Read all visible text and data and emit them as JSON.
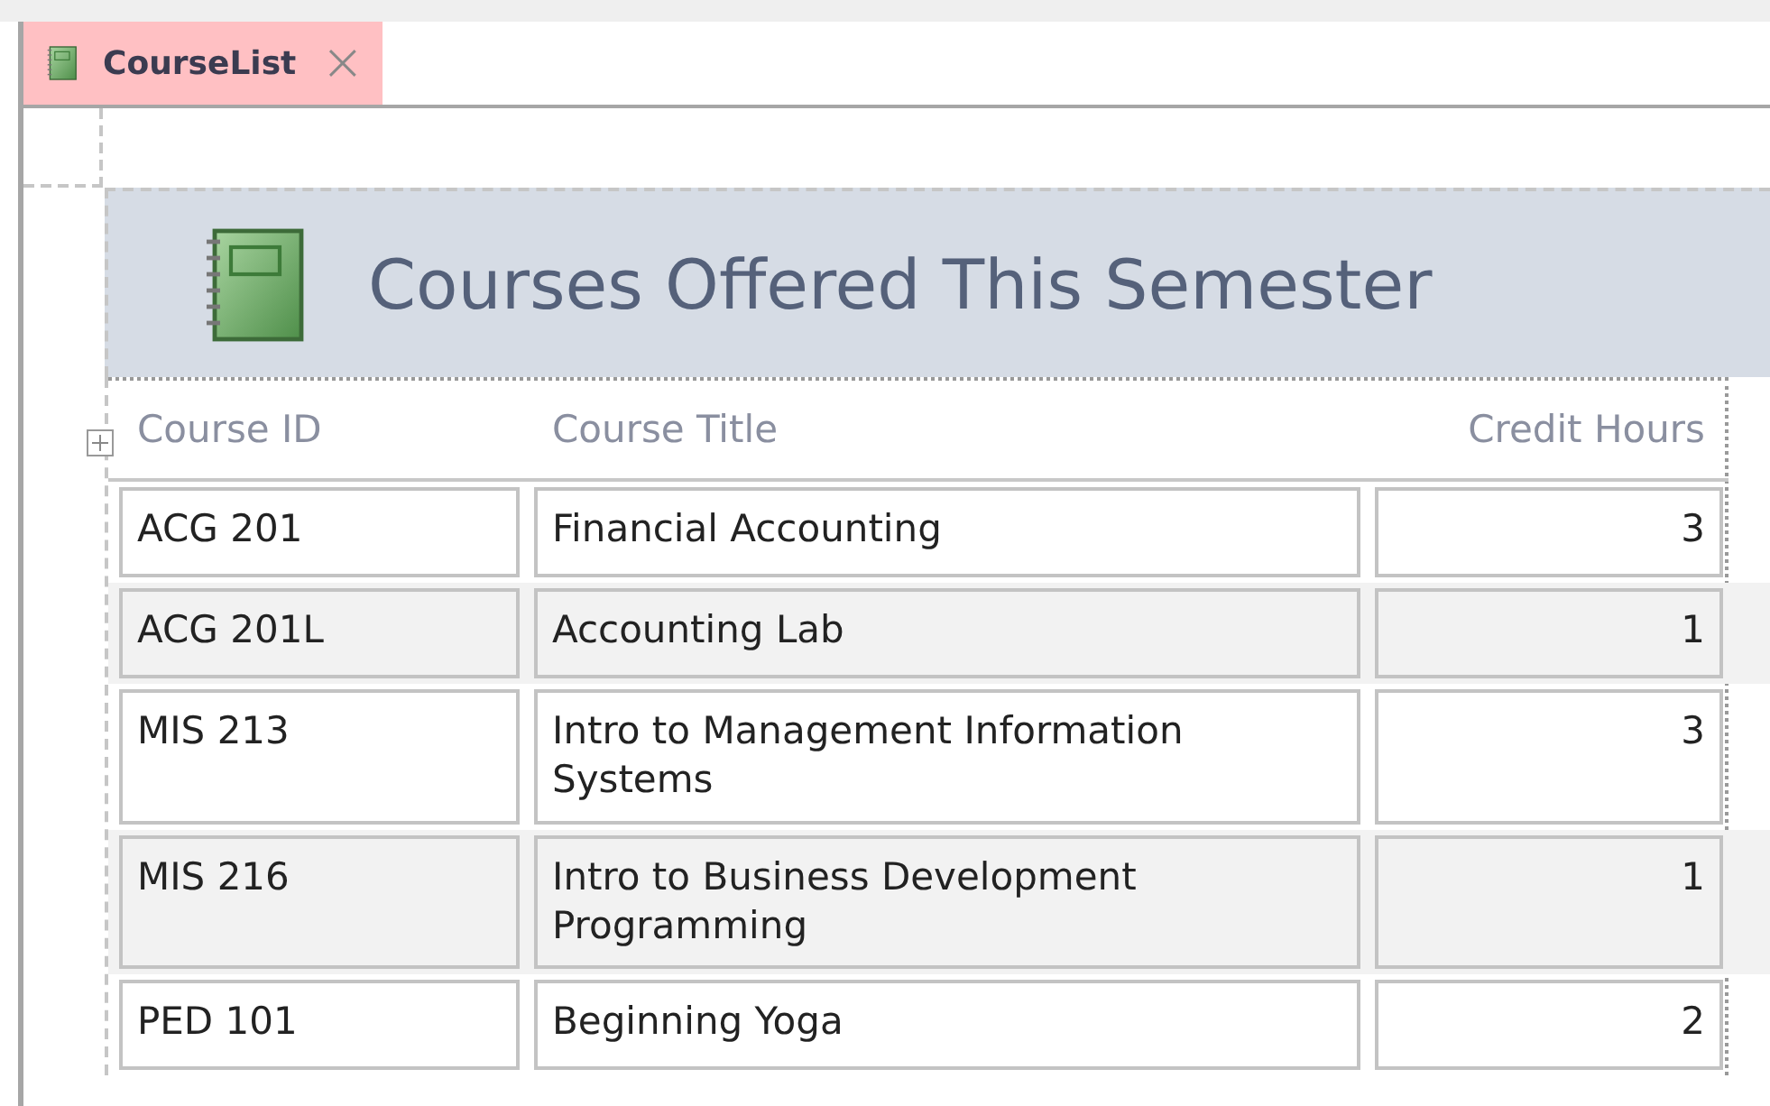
{
  "tab": {
    "label": "CourseList",
    "selected": true
  },
  "report": {
    "title": "Courses Offered This Semester"
  },
  "table": {
    "columns": [
      "Course ID",
      "Course Title",
      "Credit Hours"
    ],
    "rows": [
      {
        "course_id": "ACG 201",
        "course_title": "Financial Accounting",
        "credit_hours": "3"
      },
      {
        "course_id": "ACG 201L",
        "course_title": "Accounting Lab",
        "credit_hours": "1"
      },
      {
        "course_id": "MIS 213",
        "course_title": "Intro to Management Information Systems",
        "credit_hours": "3"
      },
      {
        "course_id": "MIS 216",
        "course_title": "Intro to Business Development Programming",
        "credit_hours": "1"
      },
      {
        "course_id": "PED 101",
        "course_title": "Beginning Yoga",
        "credit_hours": "2"
      }
    ]
  }
}
